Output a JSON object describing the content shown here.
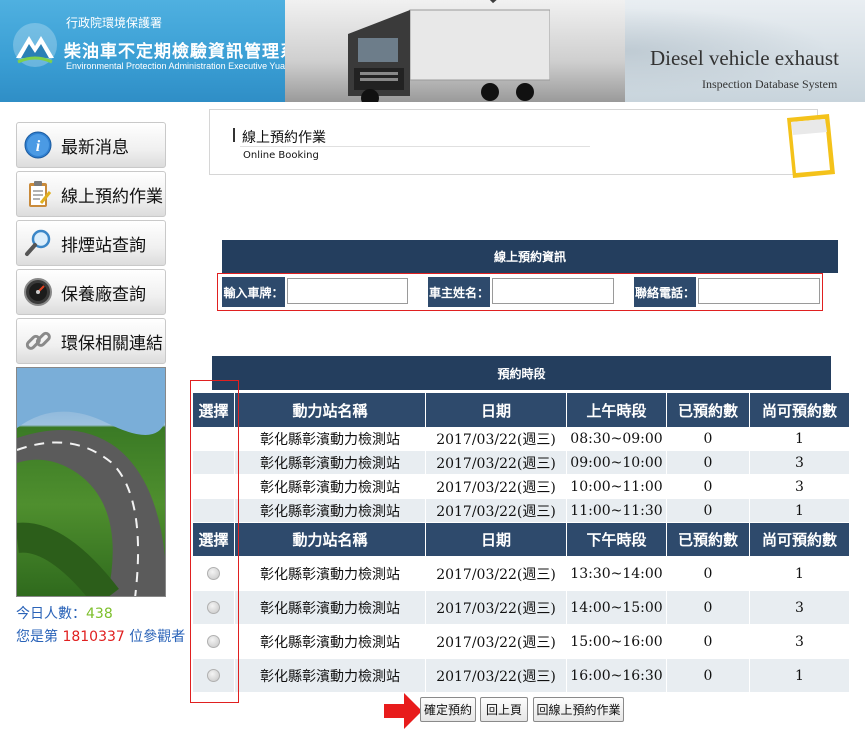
{
  "header": {
    "gov_name": "行政院環境保護署",
    "system_title": "柴油車不定期檢驗資訊管理系統",
    "system_title_en": "Environmental Protection Administration Executive Yuan, R.O.C.(Taiwan)",
    "banner_en_1": "Diesel vehicle exhaust",
    "banner_en_2": "Inspection Database System"
  },
  "sidebar": {
    "items": [
      {
        "label": "最新消息",
        "icon": "info-icon"
      },
      {
        "label": "線上預約作業",
        "icon": "clipboard-icon"
      },
      {
        "label": "排煙站查詢",
        "icon": "magnifier-icon"
      },
      {
        "label": "保養廠查詢",
        "icon": "speedometer-icon"
      },
      {
        "label": "環保相關連結",
        "icon": "chain-link-icon"
      }
    ],
    "today_label": "今日人數：",
    "today_count": "438",
    "visitor_prefix": "您是第 ",
    "visitor_count": "1810337",
    "visitor_suffix": " 位參觀者"
  },
  "page": {
    "title_zh": "線上預約作業",
    "title_en": "Online Booking"
  },
  "booking_info": {
    "heading": "線上預約資訊",
    "plate_label": "輸入車牌：",
    "plate_value": "",
    "owner_label": "車主姓名：",
    "owner_value": "",
    "phone_label": "聯絡電話：",
    "phone_value": ""
  },
  "slots": {
    "heading": "預約時段",
    "columns_am": [
      "選擇",
      "動力站名稱",
      "日期",
      "上午時段",
      "已預約數",
      "尚可預約數"
    ],
    "columns_pm": [
      "選擇",
      "動力站名稱",
      "日期",
      "下午時段",
      "已預約數",
      "尚可預約數"
    ],
    "am_rows": [
      {
        "station": "彰化縣彰濱動力檢測站",
        "date": "2017/03/22(週三)",
        "time": "08:30~09:00",
        "booked": "0",
        "available": "1"
      },
      {
        "station": "彰化縣彰濱動力檢測站",
        "date": "2017/03/22(週三)",
        "time": "09:00~10:00",
        "booked": "0",
        "available": "3"
      },
      {
        "station": "彰化縣彰濱動力檢測站",
        "date": "2017/03/22(週三)",
        "time": "10:00~11:00",
        "booked": "0",
        "available": "3"
      },
      {
        "station": "彰化縣彰濱動力檢測站",
        "date": "2017/03/22(週三)",
        "time": "11:00~11:30",
        "booked": "0",
        "available": "1"
      }
    ],
    "pm_rows": [
      {
        "station": "彰化縣彰濱動力檢測站",
        "date": "2017/03/22(週三)",
        "time": "13:30~14:00",
        "booked": "0",
        "available": "1"
      },
      {
        "station": "彰化縣彰濱動力檢測站",
        "date": "2017/03/22(週三)",
        "time": "14:00~15:00",
        "booked": "0",
        "available": "3"
      },
      {
        "station": "彰化縣彰濱動力檢測站",
        "date": "2017/03/22(週三)",
        "time": "15:00~16:00",
        "booked": "0",
        "available": "3"
      },
      {
        "station": "彰化縣彰濱動力檢測站",
        "date": "2017/03/22(週三)",
        "time": "16:00~16:30",
        "booked": "0",
        "available": "1"
      }
    ]
  },
  "actions": {
    "confirm": "確定預約",
    "back": "回上頁",
    "back_to_booking": "回線上預約作業"
  },
  "colors": {
    "header_blue": "#3a9ed4",
    "table_header": "#2e4a6c",
    "section_header": "#243e5e",
    "highlight_red": "#e02020",
    "row_alt": "#e8edf1"
  }
}
